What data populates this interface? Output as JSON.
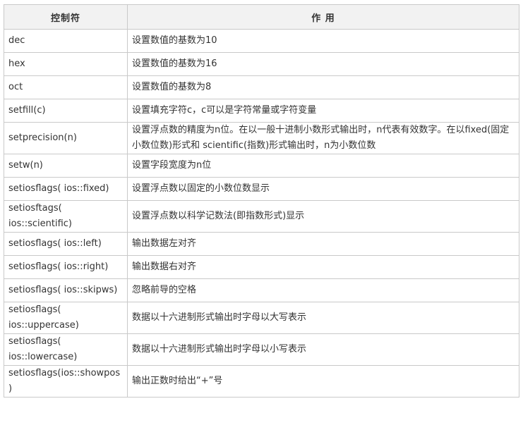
{
  "table": {
    "headers": [
      "控制符",
      "作 用"
    ],
    "rows": [
      {
        "control": "dec",
        "effect": "设置数值的基数为10",
        "tall": false
      },
      {
        "control": "hex",
        "effect": "设置数值的基数为16",
        "tall": false
      },
      {
        "control": "oct",
        "effect": "设置数值的基数为8",
        "tall": false
      },
      {
        "control": "setfill(c)",
        "effect": "设置填充字符c，c可以是字符常量或字符变量",
        "tall": false
      },
      {
        "control": "setprecision(n)",
        "effect": "设置浮点数的精度为n位。在以一般十进制小数形式输出时，n代表有效数字。在以fixed(固定小数位数)形式和 scientific(指数)形式输出时，n为小数位数",
        "tall": true
      },
      {
        "control": "setw(n)",
        "effect": "设置字段宽度为n位",
        "tall": false
      },
      {
        "control": "setiosflags( ios::fixed)",
        "effect": "设置浮点数以固定的小数位数显示",
        "tall": false
      },
      {
        "control": "setiosftags( ios::scientific)",
        "effect": "设置浮点数以科学记数法(即指数形式)显示",
        "tall": true
      },
      {
        "control": "setiosflags( ios::left)",
        "effect": "输出数据左对齐",
        "tall": false
      },
      {
        "control": "setiosflags( ios::right)",
        "effect": "输出数据右对齐",
        "tall": false
      },
      {
        "control": "setiosflags( ios::skipws)",
        "effect": "忽略前导的空格",
        "tall": false
      },
      {
        "control": "setiosflags( ios::uppercase)",
        "effect": "数据以十六进制形式输出时字母以大写表示",
        "tall": true
      },
      {
        "control": "setiosflags( ios::lowercase)",
        "effect": "数据以十六进制形式输出时字母以小写表示",
        "tall": true
      },
      {
        "control": "setiosflags(ios::showpos)",
        "effect": "输出正数时给出“+”号",
        "tall": false
      }
    ]
  }
}
